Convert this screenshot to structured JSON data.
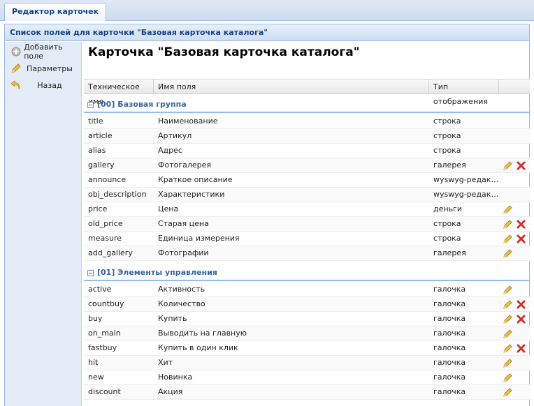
{
  "tabs": [
    {
      "label": "Редактор карточек"
    }
  ],
  "panel": {
    "title": "Список полей для карточки \"Базовая карточка каталога\""
  },
  "toolbar": {
    "add_field": "Добавить поле",
    "params": "Параметры",
    "back": "Назад"
  },
  "card": {
    "title": "Карточка \"Базовая карточка каталога\""
  },
  "columns": [
    "Техническое имя",
    "Имя поля",
    "Тип отображения"
  ],
  "groups": [
    {
      "label": "[00] Базовая группа",
      "rows": [
        {
          "tech": "title",
          "name": "Наименование",
          "type": "строка",
          "edit": false,
          "delete": false
        },
        {
          "tech": "article",
          "name": "Артикул",
          "type": "строка",
          "edit": false,
          "delete": false
        },
        {
          "tech": "alias",
          "name": "Адрес",
          "type": "строка",
          "edit": false,
          "delete": false
        },
        {
          "tech": "gallery",
          "name": "Фотогалерея",
          "type": "галерея",
          "edit": true,
          "delete": true
        },
        {
          "tech": "announce",
          "name": "Краткое описание",
          "type": "wyswyg-редакт...",
          "edit": false,
          "delete": false
        },
        {
          "tech": "obj_description",
          "name": "Характеристики",
          "type": "wyswyg-редакт...",
          "edit": false,
          "delete": false
        },
        {
          "tech": "price",
          "name": "Цена",
          "type": "деньги",
          "edit": true,
          "delete": false
        },
        {
          "tech": "old_price",
          "name": "Старая цена",
          "type": "строка",
          "edit": true,
          "delete": true
        },
        {
          "tech": "measure",
          "name": "Единица измерения",
          "type": "строка",
          "edit": true,
          "delete": true
        },
        {
          "tech": "add_gallery",
          "name": "Фотографии",
          "type": "галерея",
          "edit": true,
          "delete": false
        }
      ]
    },
    {
      "label": "[01] Элементы управления",
      "rows": [
        {
          "tech": "active",
          "name": "Активность",
          "type": "галочка",
          "edit": true,
          "delete": false
        },
        {
          "tech": "countbuy",
          "name": "Количество",
          "type": "галочка",
          "edit": true,
          "delete": true
        },
        {
          "tech": "buy",
          "name": "Купить",
          "type": "галочка",
          "edit": true,
          "delete": true
        },
        {
          "tech": "on_main",
          "name": "Выводить на главную",
          "type": "галочка",
          "edit": true,
          "delete": false
        },
        {
          "tech": "fastbuy",
          "name": "Купить в один клик",
          "type": "галочка",
          "edit": true,
          "delete": true
        },
        {
          "tech": "hit",
          "name": "Хит",
          "type": "галочка",
          "edit": true,
          "delete": false
        },
        {
          "tech": "new",
          "name": "Новинка",
          "type": "галочка",
          "edit": true,
          "delete": false
        },
        {
          "tech": "discount",
          "name": "Акция",
          "type": "галочка",
          "edit": true,
          "delete": false
        }
      ]
    }
  ],
  "icons": {
    "add": "add-circle-icon",
    "params": "pencil-icon",
    "back": "back-arrow-icon",
    "edit": "pencil-icon",
    "delete": "delete-x-icon"
  },
  "colors": {
    "header_text": "#15428b",
    "group_text": "#3764a0",
    "border": "#99bbe8",
    "delete": "#d42a2a",
    "edit": "#e8a33a"
  }
}
